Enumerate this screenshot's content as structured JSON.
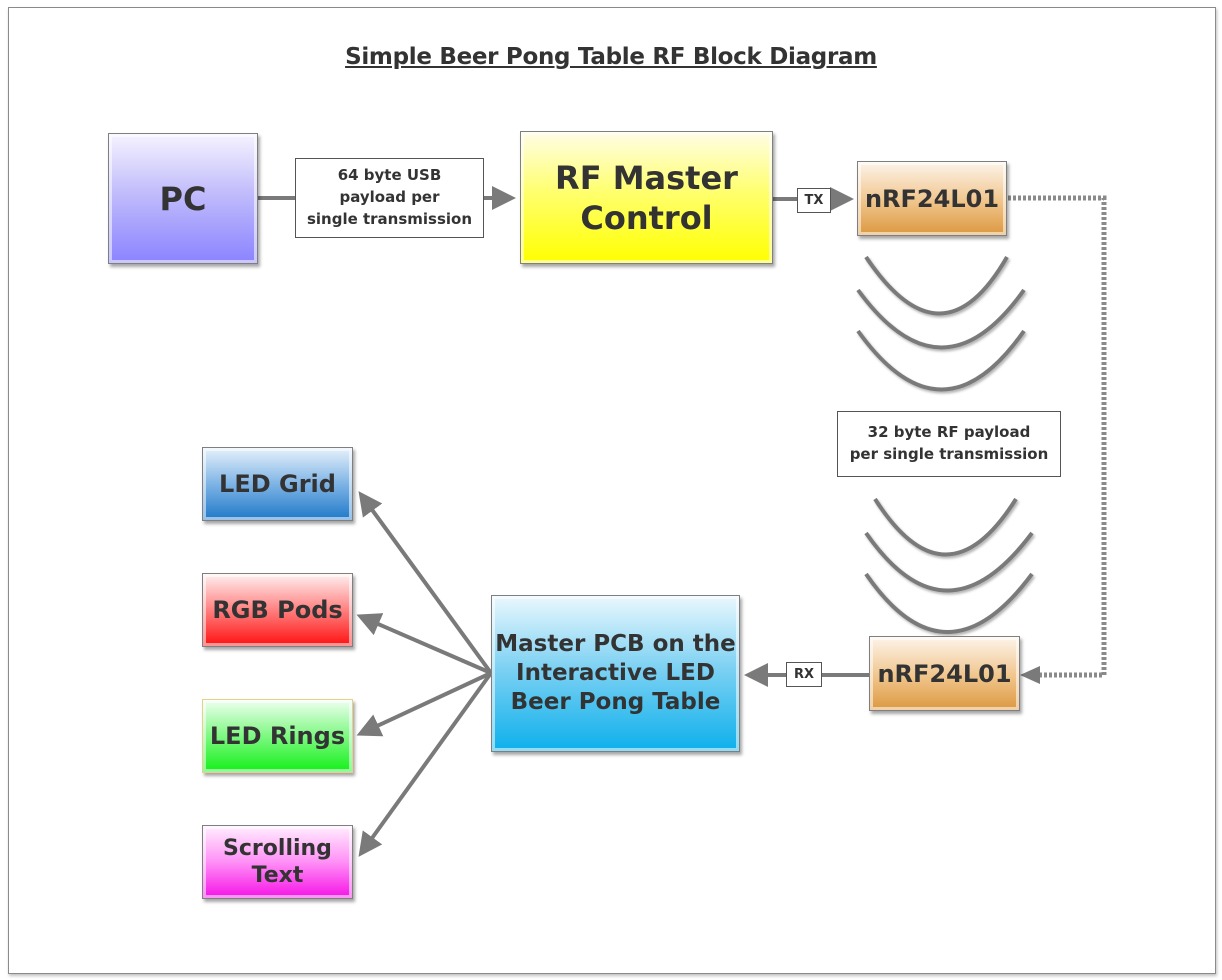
{
  "title": "Simple Beer Pong Table RF Block Diagram",
  "blocks": {
    "pc": "PC",
    "rf_master_control": [
      "RF Master",
      "Control"
    ],
    "nrf_tx": "nRF24L01",
    "nrf_rx": "nRF24L01",
    "master_pcb": [
      "Master PCB on the",
      "Interactive LED",
      "Beer Pong Table"
    ],
    "outputs": [
      {
        "label": [
          "LED Grid"
        ],
        "color": "#1f78c9"
      },
      {
        "label": [
          "RGB Pods"
        ],
        "color": "#ff1010"
      },
      {
        "label": [
          "LED Rings"
        ],
        "color": "#12f018"
      },
      {
        "label": [
          "Scrolling",
          "Text"
        ],
        "color": "#f512e6"
      }
    ]
  },
  "labels": {
    "usb_payload": [
      "64 byte USB",
      "payload per",
      "single transmission"
    ],
    "rf_payload": [
      "32 byte RF payload",
      "per single transmission"
    ],
    "tx": "TX",
    "rx": "RX"
  },
  "colors": {
    "pc": "#8a83ff",
    "rf_master_control": "#ffff00",
    "nrf": "#dc9840",
    "master_pcb": "#0db0ec",
    "connector": "#7a7a7a"
  },
  "connections": [
    {
      "from": "PC",
      "to": "RF Master Control",
      "via": "64 byte USB payload per single transmission"
    },
    {
      "from": "RF Master Control",
      "to": "nRF24L01 (TX)",
      "via": "TX"
    },
    {
      "from": "nRF24L01 (TX)",
      "to": "nRF24L01 (RX)",
      "via": "32 byte RF payload per single transmission",
      "style": "wireless / dotted"
    },
    {
      "from": "nRF24L01 (RX)",
      "to": "Master PCB",
      "via": "RX"
    },
    {
      "from": "Master PCB",
      "to": "LED Grid"
    },
    {
      "from": "Master PCB",
      "to": "RGB Pods"
    },
    {
      "from": "Master PCB",
      "to": "LED Rings"
    },
    {
      "from": "Master PCB",
      "to": "Scrolling Text"
    }
  ]
}
